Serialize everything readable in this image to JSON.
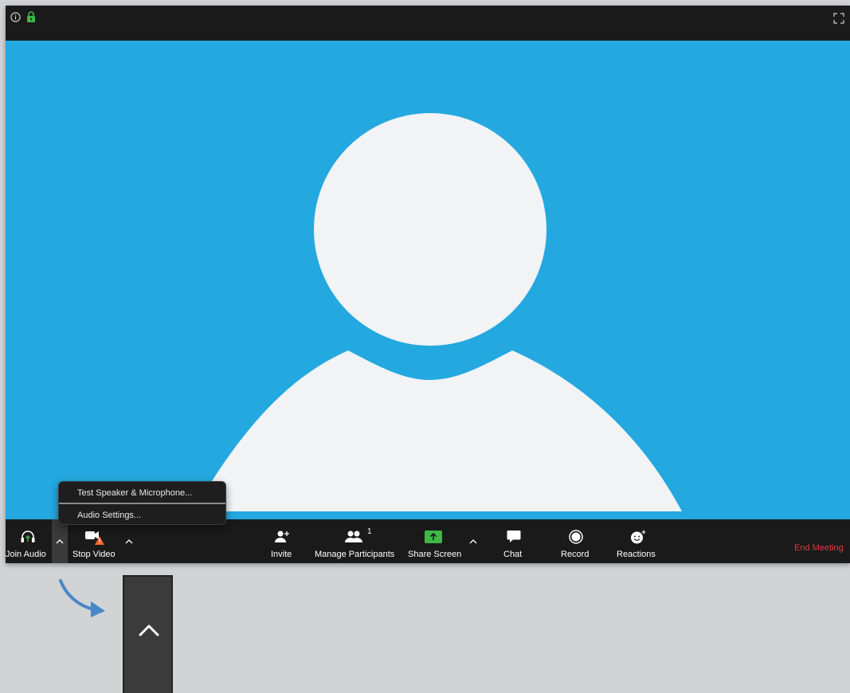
{
  "colors": {
    "video_background": "#24a8e0",
    "avatar_fill": "#f1f3f5",
    "toolbar_background": "#1a1a1a",
    "end_meeting": "#e8393f",
    "share_green": "#3fb846",
    "warning_orange": "#f26522",
    "arrow_blue": "#4a86c8"
  },
  "icons": {
    "info": "info-icon",
    "lock": "lock-icon",
    "fullscreen": "fullscreen-icon"
  },
  "audio_menu": {
    "items": [
      {
        "label": "Test Speaker & Microphone..."
      },
      {
        "label": "Audio Settings..."
      }
    ]
  },
  "toolbar": {
    "join_audio": "Join Audio",
    "stop_video": "Stop Video",
    "invite": "Invite",
    "manage_participants": "Manage Participants",
    "participant_count": "1",
    "share_screen": "Share Screen",
    "chat": "Chat",
    "record": "Record",
    "reactions": "Reactions",
    "end_meeting": "End Meeting"
  }
}
